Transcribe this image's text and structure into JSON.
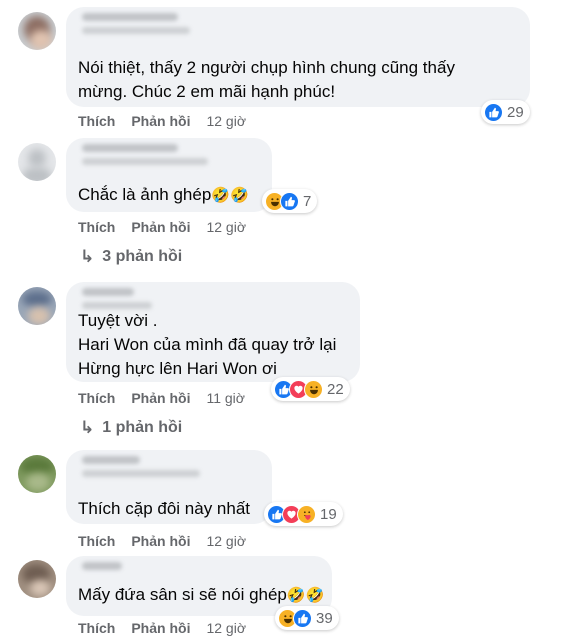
{
  "like_label": "Thích",
  "reply_label": "Phản hồi",
  "comments": [
    {
      "lines": [
        "Nói thiệt, thấy 2 người chụp hình chung cũng thấy",
        "mừng. Chúc 2 em mãi hạnh phúc!"
      ],
      "reaction_icons": [
        "like-icon"
      ],
      "reaction_count": "29",
      "time": "12 giờ"
    },
    {
      "lines": [
        "Chắc là ảnh ghép"
      ],
      "emoji": "🤣🤣",
      "reaction_icons": [
        "haha-icon",
        "like-icon"
      ],
      "reaction_count": "7",
      "time": "12 giờ",
      "replies": "3 phản hồi"
    },
    {
      "lines": [
        "Tuyệt vời .",
        "Hari Won của mình đã quay trở lại",
        "Hừng hực lên Hari Won ơi"
      ],
      "reaction_icons": [
        "like-icon",
        "love-icon",
        "haha-icon"
      ],
      "reaction_count": "22",
      "time": "11 giờ",
      "replies": "1 phản hồi"
    },
    {
      "lines": [
        "Thích cặp đôi này nhất"
      ],
      "reaction_icons": [
        "like-icon",
        "love-icon",
        "care-icon"
      ],
      "reaction_count": "19",
      "time": "12 giờ"
    },
    {
      "lines": [
        "Mấy đứa sân si sẽ nói ghép"
      ],
      "emoji": "🤣🤣",
      "reaction_icons": [
        "haha-icon",
        "like-icon"
      ],
      "reaction_count": "39",
      "time": "12 giờ"
    }
  ],
  "reply_arrow": "↳",
  "colors": {
    "bubble": "#f0f2f5",
    "like": "#1877f2",
    "love": "#f33e58",
    "haha": "#f7b125",
    "meta": "#65676b"
  }
}
